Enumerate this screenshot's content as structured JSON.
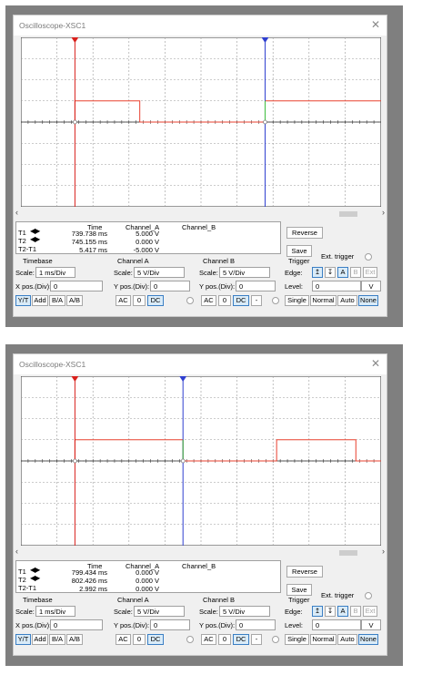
{
  "screens": [
    {
      "window_title": "Oscilloscope-XSC1",
      "close_glyph": "✕",
      "readout": {
        "headers": {
          "time": "Time",
          "a": "Channel_A",
          "b": "Channel_B"
        },
        "t1": {
          "label": "T1",
          "time": "739.738 ms",
          "a": "5.000 V",
          "b": ""
        },
        "t2": {
          "label": "T2",
          "time": "745.155 ms",
          "a": "0.000 V",
          "b": ""
        },
        "diff": {
          "label": "T2-T1",
          "time": "5.417 ms",
          "a": "-5.000 V",
          "b": ""
        }
      },
      "trace": {
        "t1_div": -3.5,
        "t2_div": 1.78,
        "pulse_start_div": 1.78,
        "pulse_end_div": -1.7
      }
    },
    {
      "window_title": "Oscilloscope-XSC1",
      "close_glyph": "✕",
      "readout": {
        "headers": {
          "time": "Time",
          "a": "Channel_A",
          "b": "Channel_B"
        },
        "t1": {
          "label": "T1",
          "time": "799.434 ms",
          "a": "0.000 V",
          "b": ""
        },
        "t2": {
          "label": "T2",
          "time": "802.426 ms",
          "a": "0.000 V",
          "b": ""
        },
        "diff": {
          "label": "T2-T1",
          "time": "2.992 ms",
          "a": "0.000 V",
          "b": ""
        }
      },
      "trace": {
        "t1_div": -3.5,
        "t2_div": -0.5,
        "pulse_start_div": 2.1,
        "pulse_end_div": -0.5
      }
    }
  ],
  "controls": {
    "reverse": "Reverse",
    "save": "Save",
    "ext_trigger": "Ext. trigger",
    "timebase": {
      "title": "Timebase",
      "scale_label": "Scale:",
      "scale": "1 ms/Div",
      "xpos_label": "X pos.(Div):",
      "xpos": "0",
      "modes": [
        "Y/T",
        "Add",
        "B/A",
        "A/B"
      ]
    },
    "channel_a": {
      "title": "Channel A",
      "scale_label": "Scale:",
      "scale": "5 V/Div",
      "ypos_label": "Y pos.(Div):",
      "ypos": "0",
      "coupling": [
        "AC",
        "0",
        "DC"
      ]
    },
    "channel_b": {
      "title": "Channel B",
      "scale_label": "Scale:",
      "scale": "5 V/Div",
      "ypos_label": "Y pos.(Div):",
      "ypos": "0",
      "coupling": [
        "AC",
        "0",
        "DC",
        "-"
      ]
    },
    "trigger": {
      "title": "Trigger",
      "edge_label": "Edge:",
      "level_label": "Level:",
      "level": "0",
      "level_unit": "V",
      "edge_sources": [
        "A",
        "B",
        "Ext"
      ],
      "modes": [
        "Single",
        "Normal",
        "Auto",
        "None"
      ]
    }
  },
  "colors": {
    "channel_a": "#e8402f",
    "cursor1": "#d9201b",
    "cursor2": "#2f3fcf",
    "accent": "#3b7fc4"
  }
}
